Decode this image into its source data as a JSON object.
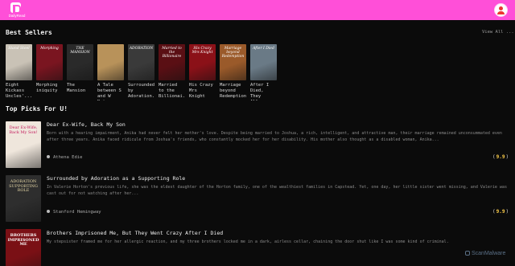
{
  "header": {
    "logo_text": "DailyRead",
    "brand_color": "#ff4fd8"
  },
  "best_sellers": {
    "title": "Best Sellers",
    "view_all": "View All ...",
    "books": [
      {
        "title": "Eight Kickass Uncles'...",
        "cover_text": "Stand Steel",
        "cover_color": "#c9c2b6"
      },
      {
        "title": "Morphing iniquity",
        "cover_text": "Morphing",
        "cover_color": "#7a1520"
      },
      {
        "title": "The Mansion",
        "cover_text": "THE MANSION",
        "cover_color": "#2a2a2a"
      },
      {
        "title": "A Tale between S and W Not...",
        "cover_text": "",
        "cover_color": "#b8925a"
      },
      {
        "title": "Surrounded by Adoration...",
        "cover_text": "ADORATION",
        "cover_color": "#3a3a3a"
      },
      {
        "title": "Married to the Billionai...",
        "cover_text": "Married to the Billionaire",
        "cover_color": "#5a0f14"
      },
      {
        "title": "His Crazy Mrs Knight",
        "cover_text": "His Crazy Mrs Knight",
        "cover_color": "#8b1118"
      },
      {
        "title": "Marriage beyond Redemption",
        "cover_text": "Marriage beyond Redemption",
        "cover_color": "#9a5a2a"
      },
      {
        "title": "After I Died, They All...",
        "cover_text": "After I Died",
        "cover_color": "#6a7a86"
      }
    ]
  },
  "top_picks": {
    "title": "Top Picks For U!",
    "items": [
      {
        "title": "Dear Ex-Wife, Back My Son",
        "description": "Born with a hearing impairment, Anika had never felt her mother's love. Despite being married to Joshua, a rich, intelligent, and attractive man, their marriage remained unconsummated even after three years. Anika faced ridicule from Joshua's friends, who constantly mocked her for her disability. His mother also thought as a disabled woman, Anika...",
        "author": "Athena Edie",
        "rating": "9.9",
        "cover_text": "Dear Ex-Wife, Back My Son!",
        "cover_color": "#efe6dc"
      },
      {
        "title": "Surrounded by Adoration as a Supporting Role",
        "description": "In Valerie Horton's previous life, she was the eldest daughter of the Horton family, one of the wealthiest families in Capstead. Yet, one day, her little sister went missing, and Valerie was cast out for not watching after her...",
        "author": "Stanford Hemingway",
        "rating": "9.9",
        "cover_text": "ADORATION SUPPORTING ROLE",
        "cover_color": "#2e2e2e"
      },
      {
        "title": "Brothers Imprisoned Me, But They Went Crazy After I Died",
        "description": "My stepsister framed me for her allergic reaction, and my three brothers locked me in a dark, airless cellar, chaining the door shut like I was some kind of criminal.",
        "author": "",
        "rating": "",
        "cover_text": "BROTHERS IMPRISONED ME",
        "cover_color": "#7a1015"
      }
    ]
  },
  "watermark": "ScanMalware"
}
